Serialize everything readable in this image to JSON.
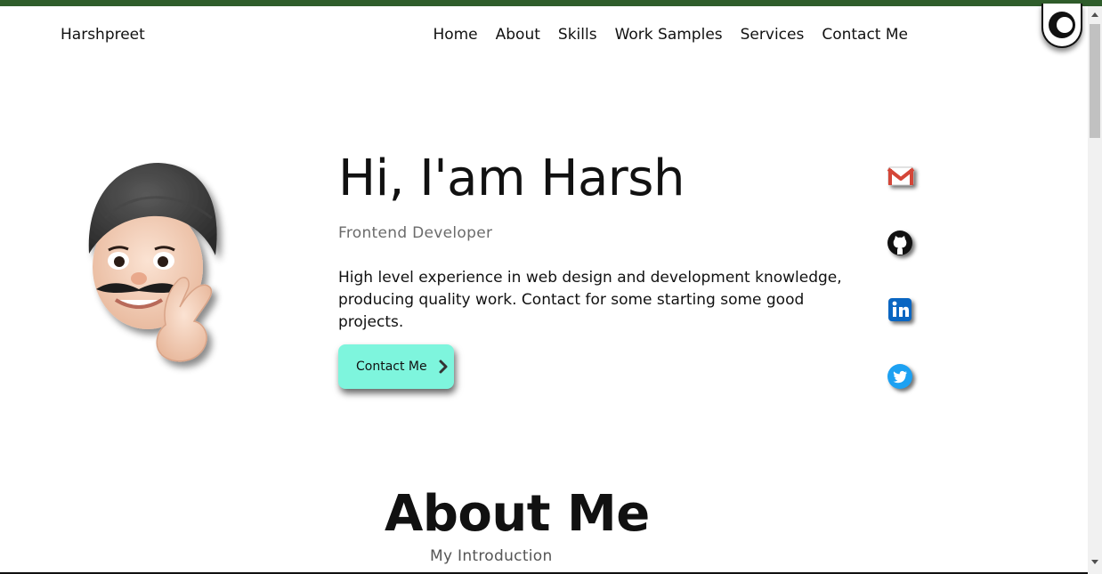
{
  "nav": {
    "brand": "Harshpreet",
    "links": [
      "Home",
      "About",
      "Skills",
      "Work Samples",
      "Services",
      "Contact Me"
    ]
  },
  "theme_toggle": {
    "icon": "moon-icon"
  },
  "hero": {
    "title": "Hi, I'am Harsh",
    "subtitle": "Frontend Developer",
    "description": "High level experience in web design and development knowledge, producing quality work. Contact for some starting some good projects.",
    "cta_label": "Contact Me",
    "cta_icon": "chevron-right-icon"
  },
  "social": [
    {
      "icon": "gmail-icon",
      "color": "#d44638"
    },
    {
      "icon": "github-icon",
      "color": "#111111"
    },
    {
      "icon": "linkedin-icon",
      "color": "#0a66c2"
    },
    {
      "icon": "twitter-icon",
      "color": "#1da1f2"
    }
  ],
  "about": {
    "title": "About Me",
    "subtitle": "My Introduction"
  },
  "colors": {
    "top_strip": "#2f5d2b",
    "cta_background": "#7ef5dd",
    "subtitle_text": "#6b6b6b"
  }
}
